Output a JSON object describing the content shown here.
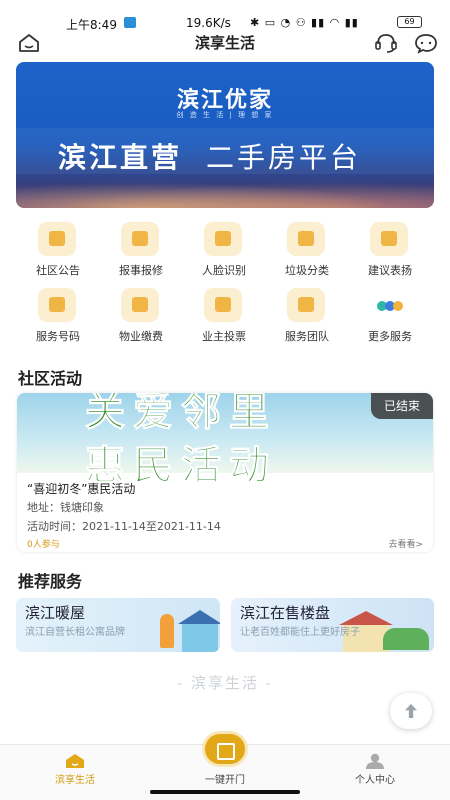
{
  "status_bar": {
    "time": "上午8:49",
    "net_speed": "19.6K/s",
    "indicators": "✱ ▭ ◔ ⚇ ▮▮ ◠ ▮▮",
    "battery": "69"
  },
  "header": {
    "title": "滨享生活",
    "icons": [
      "home-icon",
      "customer-service-icon",
      "message-icon"
    ]
  },
  "banner": {
    "logo": "滨江优家",
    "logo_sub": "创 造 生 活 | 理 想 家",
    "headline_bold": "滨江直营",
    "headline_light": "二手房平台"
  },
  "services_grid": [
    {
      "label": "社区公告",
      "icon": "notice-icon"
    },
    {
      "label": "报事报修",
      "icon": "repair-icon"
    },
    {
      "label": "人脸识别",
      "icon": "face-scan-icon"
    },
    {
      "label": "垃圾分类",
      "icon": "garbage-truck-icon"
    },
    {
      "label": "建议表扬",
      "icon": "feedback-icon"
    },
    {
      "label": "服务号码",
      "icon": "phone-book-icon"
    },
    {
      "label": "物业缴费",
      "icon": "payment-icon"
    },
    {
      "label": "业主投票",
      "icon": "vote-icon"
    },
    {
      "label": "服务团队",
      "icon": "team-icon"
    },
    {
      "label": "更多服务",
      "icon": "more-dots-icon"
    }
  ],
  "activity_section": {
    "title": "社区活动",
    "card": {
      "image_text_line1": "关爱邻里",
      "image_text_line2": "惠民活动",
      "status_badge": "已结束",
      "name": "“喜迎初冬”惠民活动",
      "address": "地址：钱塘印象",
      "time": "活动时间：2021-11-14至2021-11-14",
      "participants": "0人参与",
      "more_link": "去看看>"
    }
  },
  "recommend_section": {
    "title": "推荐服务",
    "cards": [
      {
        "title": "滨江暖屋",
        "subtitle": "滨江自营长租公寓品牌"
      },
      {
        "title": "滨江在售楼盘",
        "subtitle": "让老百姓都能住上更好房子"
      }
    ]
  },
  "footer_brand": "- 滨享生活 -",
  "tabbar": [
    {
      "label": "滨享生活",
      "icon": "home-tab-icon",
      "active": true
    },
    {
      "label": "一键开门",
      "icon": "unlock-icon",
      "active": false
    },
    {
      "label": "个人中心",
      "icon": "profile-icon",
      "active": false
    }
  ],
  "colors": {
    "accent": "#e2a817",
    "active_tab": "#d39a10",
    "banner_blue": "#1d63c9",
    "icon_bg": "#fbefcf"
  }
}
